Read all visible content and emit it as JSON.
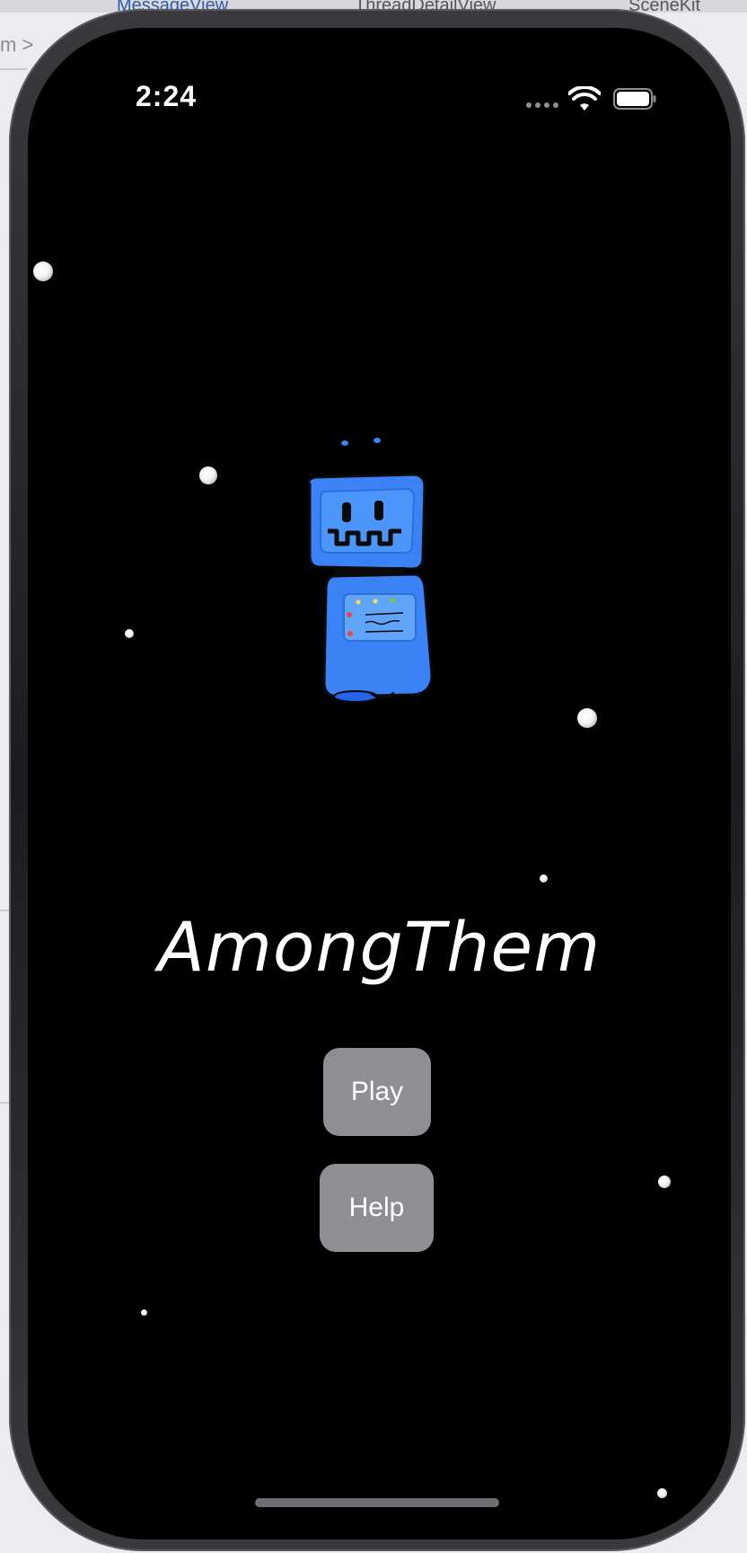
{
  "host": {
    "tabs": [
      "MessageView",
      "ThreadDetailView",
      "SceneKit"
    ],
    "breadcrumb": "m  >"
  },
  "status_bar": {
    "time": "2:24",
    "wifi_icon": "wifi-icon",
    "battery_icon": "battery-icon"
  },
  "app": {
    "title": "AmongThem",
    "play_label": "Play",
    "help_label": "Help",
    "mascot_icon": "robot-icon"
  },
  "colors": {
    "background": "#000000",
    "button": "#8e8e93",
    "robot_blue": "#3b82f6",
    "text": "#ffffff"
  }
}
